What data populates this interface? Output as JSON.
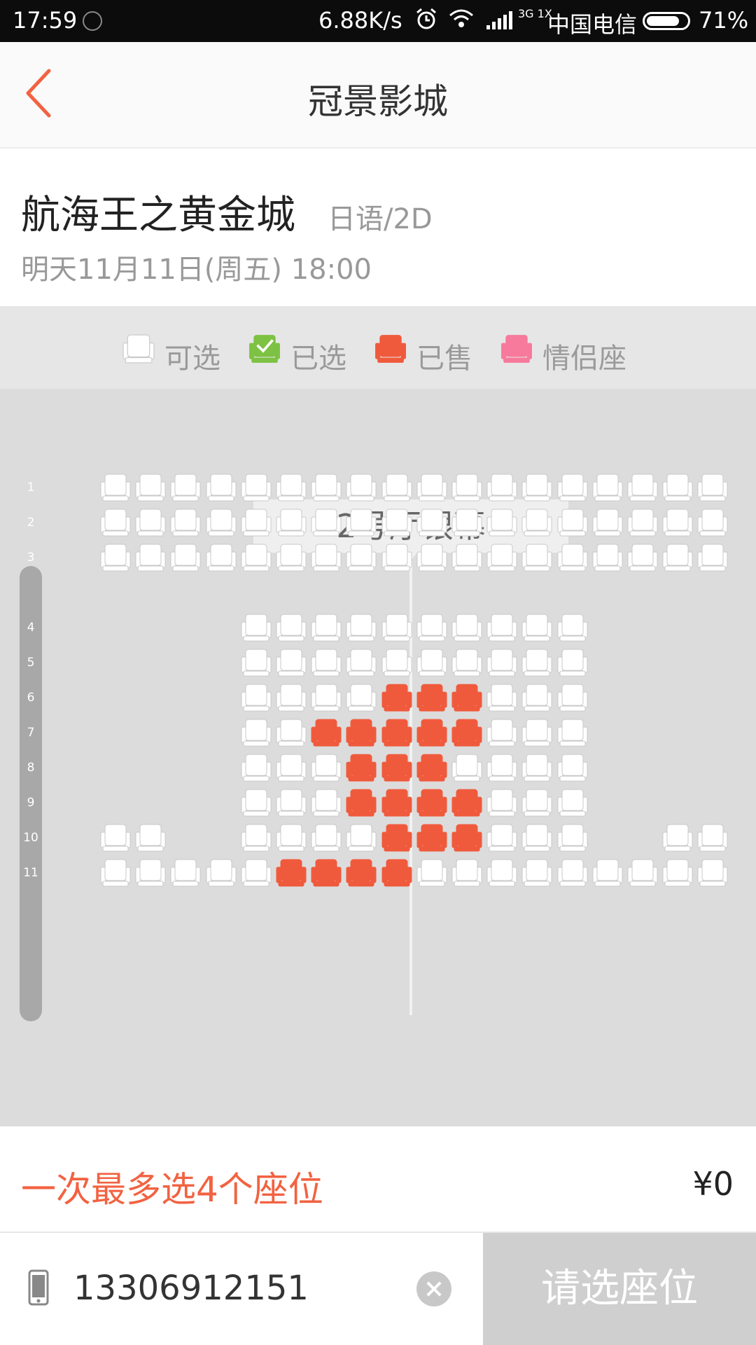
{
  "status_bar": {
    "time": "17:59",
    "net_speed": "6.88K/s",
    "network_gen": "3G 1X",
    "carrier": "中国电信",
    "battery": "71%"
  },
  "header": {
    "title": "冠景影城"
  },
  "movie": {
    "name": "航海王之黄金城",
    "lang": "日语/2D",
    "showtime": "明天11月11日(周五) 18:00"
  },
  "legend": [
    {
      "label": "可选",
      "state": "available",
      "color": "#ffffff"
    },
    {
      "label": "已选",
      "state": "selected",
      "color": "#7dc242"
    },
    {
      "label": "已售",
      "state": "sold",
      "color": "#f05a3c"
    },
    {
      "label": "情侣座",
      "state": "couple",
      "color": "#f7799b"
    }
  ],
  "hall": {
    "screen_label": "2号厅银幕"
  },
  "seating": {
    "row_labels": [
      "1",
      "2",
      "3",
      "4",
      "5",
      "6",
      "7",
      "8",
      "9",
      "10",
      "11"
    ],
    "rows": [
      {
        "label": "1",
        "seats": [
          0,
          0,
          0,
          0,
          0,
          0,
          0,
          0,
          0,
          0,
          0,
          0,
          0,
          0,
          0,
          0,
          0,
          0
        ]
      },
      {
        "label": "2",
        "seats": [
          0,
          0,
          0,
          0,
          0,
          0,
          0,
          0,
          0,
          0,
          0,
          0,
          0,
          0,
          0,
          0,
          0,
          0
        ]
      },
      {
        "label": "3",
        "seats": [
          0,
          0,
          0,
          0,
          0,
          0,
          0,
          0,
          0,
          0,
          0,
          0,
          0,
          0,
          0,
          0,
          0,
          0
        ]
      },
      {
        "label": "4",
        "seats": [
          null,
          null,
          null,
          null,
          0,
          0,
          0,
          0,
          0,
          0,
          0,
          0,
          0,
          0,
          null,
          null,
          null,
          null
        ]
      },
      {
        "label": "5",
        "seats": [
          null,
          null,
          null,
          null,
          0,
          0,
          0,
          0,
          0,
          0,
          0,
          0,
          0,
          0,
          null,
          null,
          null,
          null
        ]
      },
      {
        "label": "6",
        "seats": [
          null,
          null,
          null,
          null,
          0,
          0,
          0,
          0,
          1,
          1,
          1,
          0,
          0,
          0,
          null,
          null,
          null,
          null
        ]
      },
      {
        "label": "7",
        "seats": [
          null,
          null,
          null,
          null,
          0,
          0,
          1,
          1,
          1,
          1,
          1,
          0,
          0,
          0,
          null,
          null,
          null,
          null
        ]
      },
      {
        "label": "8",
        "seats": [
          null,
          null,
          null,
          null,
          0,
          0,
          0,
          1,
          1,
          1,
          0,
          0,
          0,
          0,
          null,
          null,
          null,
          null
        ]
      },
      {
        "label": "9",
        "seats": [
          null,
          null,
          null,
          null,
          0,
          0,
          0,
          1,
          1,
          1,
          1,
          0,
          0,
          0,
          null,
          null,
          null,
          null
        ]
      },
      {
        "label": "10",
        "seats": [
          0,
          0,
          null,
          null,
          0,
          0,
          0,
          0,
          1,
          1,
          1,
          0,
          0,
          0,
          null,
          null,
          0,
          0
        ]
      },
      {
        "label": "11",
        "seats": [
          0,
          0,
          0,
          0,
          0,
          1,
          1,
          1,
          1,
          0,
          0,
          0,
          0,
          0,
          0,
          0,
          0,
          0
        ]
      }
    ],
    "state_legend": {
      "0": "available",
      "1": "sold"
    }
  },
  "footer": {
    "limit_text": "一次最多选4个座位",
    "price": "¥0",
    "phone_value": "13306912151",
    "submit_label": "请选座位"
  },
  "colors": {
    "accent": "#f26241",
    "sold": "#f05a3c",
    "selected": "#7dc242",
    "couple": "#f7799b",
    "available": "#ffffff",
    "submit_bg": "#cfcfcf"
  },
  "icons": [
    "chevron-left-icon",
    "phone-icon",
    "clear-icon",
    "alarm-icon",
    "wifi-icon",
    "signal-icon",
    "battery-icon"
  ]
}
